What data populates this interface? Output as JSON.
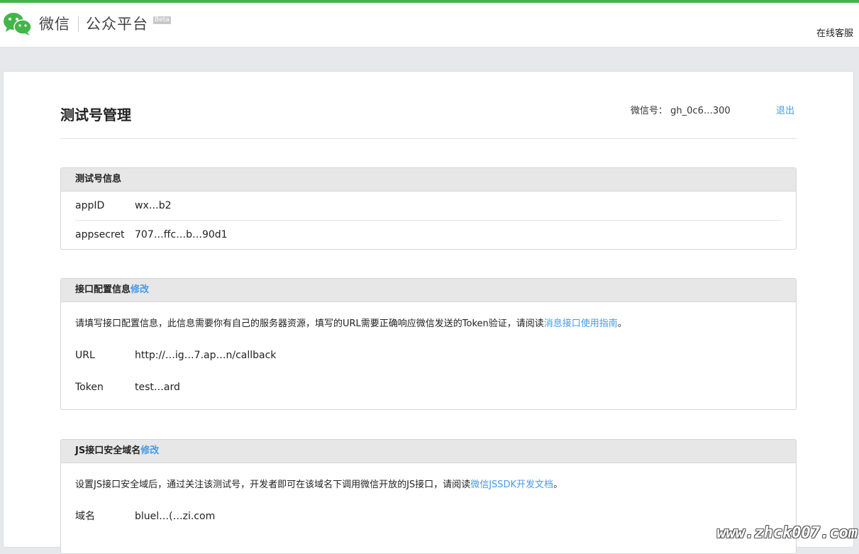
{
  "header": {
    "brand": "微信",
    "platform": "公众平台",
    "beta": "Beta",
    "service": "在线客服"
  },
  "page": {
    "title": "测试号管理",
    "account_label": "微信号：",
    "account_value": "gh_0c6…300",
    "logout": "退出"
  },
  "test_info": {
    "title": "测试号信息",
    "appid_label": "appID",
    "appid_value": "wx…b2",
    "secret_label": "appsecret",
    "secret_value": "707…ffc…b…90d1"
  },
  "interface": {
    "title": "接口配置信息",
    "edit": "修改",
    "desc": "请填写接口配置信息，此信息需要你有自己的服务器资源，填写的URL需要正确响应微信发送的Token验证，请阅读",
    "desc_link": "消息接口使用指南",
    "desc_end": "。",
    "url_label": "URL",
    "url_value": "http://…ig…7.ap…n/callback",
    "token_label": "Token",
    "token_value": "test…ard"
  },
  "js": {
    "title": "JS接口安全域名",
    "edit": "修改",
    "desc": "设置JS接口安全域后，通过关注该测试号，开发者即可在该域名下调用微信开放的JS接口，请阅读",
    "desc_link": "微信JSSDK开发文档",
    "desc_end": "。",
    "domain_label": "域名",
    "domain_value": "bluel…(…zi.com"
  },
  "watermark": "www.zhck007.com",
  "colors": {
    "accent_green": "#44b549",
    "link_blue": "#459ae9"
  }
}
